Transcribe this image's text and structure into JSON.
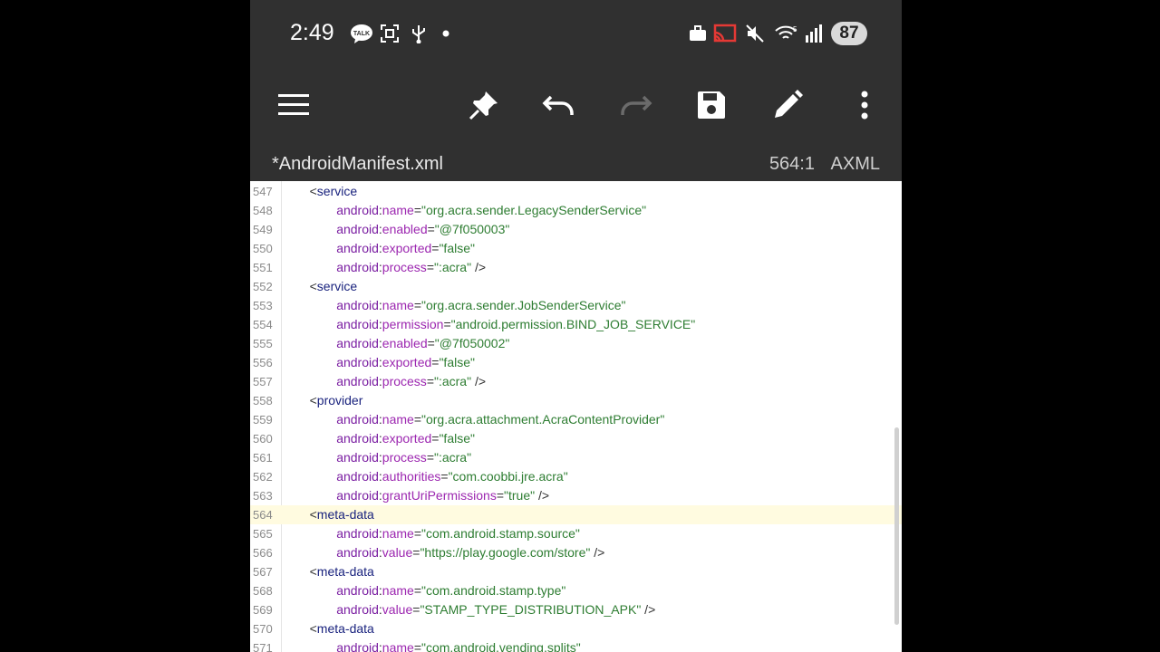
{
  "status_bar": {
    "time": "2:49",
    "icons_left": [
      "talk-icon",
      "screen-capture-icon",
      "usb-icon",
      "dot-icon"
    ],
    "icons_right": [
      "briefcase-icon",
      "cast-icon",
      "mute-icon",
      "wifi-icon",
      "signal-icon"
    ],
    "battery": "87"
  },
  "toolbar": {
    "buttons": [
      "menu-icon",
      "pin-icon",
      "undo-icon",
      "redo-icon",
      "save-icon",
      "edit-icon",
      "more-icon"
    ]
  },
  "file_info": {
    "filename": "*AndroidManifest.xml",
    "cursor_position": "564:1",
    "mode": "AXML"
  },
  "editor": {
    "current_line": "564",
    "lines": [
      {
        "n": "547",
        "indent": "    ",
        "parts": [
          [
            "punct",
            "<"
          ],
          [
            "tag",
            "service"
          ]
        ]
      },
      {
        "n": "548",
        "indent": "        ",
        "parts": [
          [
            "attrns",
            "android"
          ],
          [
            "punct",
            ":"
          ],
          [
            "attr",
            "name"
          ],
          [
            "punct",
            "="
          ],
          [
            "val",
            "\"org.acra.sender.LegacySenderService\""
          ]
        ]
      },
      {
        "n": "549",
        "indent": "        ",
        "parts": [
          [
            "attrns",
            "android"
          ],
          [
            "punct",
            ":"
          ],
          [
            "attr",
            "enabled"
          ],
          [
            "punct",
            "="
          ],
          [
            "val",
            "\"@7f050003\""
          ]
        ]
      },
      {
        "n": "550",
        "indent": "        ",
        "parts": [
          [
            "attrns",
            "android"
          ],
          [
            "punct",
            ":"
          ],
          [
            "attr",
            "exported"
          ],
          [
            "punct",
            "="
          ],
          [
            "val",
            "\"false\""
          ]
        ]
      },
      {
        "n": "551",
        "indent": "        ",
        "parts": [
          [
            "attrns",
            "android"
          ],
          [
            "punct",
            ":"
          ],
          [
            "attr",
            "process"
          ],
          [
            "punct",
            "="
          ],
          [
            "val",
            "\":acra\""
          ],
          [
            "punct",
            " />"
          ]
        ]
      },
      {
        "n": "552",
        "indent": "    ",
        "parts": [
          [
            "punct",
            "<"
          ],
          [
            "tag",
            "service"
          ]
        ]
      },
      {
        "n": "553",
        "indent": "        ",
        "parts": [
          [
            "attrns",
            "android"
          ],
          [
            "punct",
            ":"
          ],
          [
            "attr",
            "name"
          ],
          [
            "punct",
            "="
          ],
          [
            "val",
            "\"org.acra.sender.JobSenderService\""
          ]
        ]
      },
      {
        "n": "554",
        "indent": "        ",
        "parts": [
          [
            "attrns",
            "android"
          ],
          [
            "punct",
            ":"
          ],
          [
            "attr",
            "permission"
          ],
          [
            "punct",
            "="
          ],
          [
            "val",
            "\"android.permission.BIND_JOB_SERVICE\""
          ]
        ]
      },
      {
        "n": "555",
        "indent": "        ",
        "parts": [
          [
            "attrns",
            "android"
          ],
          [
            "punct",
            ":"
          ],
          [
            "attr",
            "enabled"
          ],
          [
            "punct",
            "="
          ],
          [
            "val",
            "\"@7f050002\""
          ]
        ]
      },
      {
        "n": "556",
        "indent": "        ",
        "parts": [
          [
            "attrns",
            "android"
          ],
          [
            "punct",
            ":"
          ],
          [
            "attr",
            "exported"
          ],
          [
            "punct",
            "="
          ],
          [
            "val",
            "\"false\""
          ]
        ]
      },
      {
        "n": "557",
        "indent": "        ",
        "parts": [
          [
            "attrns",
            "android"
          ],
          [
            "punct",
            ":"
          ],
          [
            "attr",
            "process"
          ],
          [
            "punct",
            "="
          ],
          [
            "val",
            "\":acra\""
          ],
          [
            "punct",
            " />"
          ]
        ]
      },
      {
        "n": "558",
        "indent": "    ",
        "parts": [
          [
            "punct",
            "<"
          ],
          [
            "tag",
            "provider"
          ]
        ]
      },
      {
        "n": "559",
        "indent": "        ",
        "parts": [
          [
            "attrns",
            "android"
          ],
          [
            "punct",
            ":"
          ],
          [
            "attr",
            "name"
          ],
          [
            "punct",
            "="
          ],
          [
            "val",
            "\"org.acra.attachment.AcraContentProvider\""
          ]
        ]
      },
      {
        "n": "560",
        "indent": "        ",
        "parts": [
          [
            "attrns",
            "android"
          ],
          [
            "punct",
            ":"
          ],
          [
            "attr",
            "exported"
          ],
          [
            "punct",
            "="
          ],
          [
            "val",
            "\"false\""
          ]
        ]
      },
      {
        "n": "561",
        "indent": "        ",
        "parts": [
          [
            "attrns",
            "android"
          ],
          [
            "punct",
            ":"
          ],
          [
            "attr",
            "process"
          ],
          [
            "punct",
            "="
          ],
          [
            "val",
            "\":acra\""
          ]
        ]
      },
      {
        "n": "562",
        "indent": "        ",
        "parts": [
          [
            "attrns",
            "android"
          ],
          [
            "punct",
            ":"
          ],
          [
            "attr",
            "authorities"
          ],
          [
            "punct",
            "="
          ],
          [
            "val",
            "\"com.coobbi.jre.acra\""
          ]
        ]
      },
      {
        "n": "563",
        "indent": "        ",
        "parts": [
          [
            "attrns",
            "android"
          ],
          [
            "punct",
            ":"
          ],
          [
            "attr",
            "grantUriPermissions"
          ],
          [
            "punct",
            "="
          ],
          [
            "val",
            "\"true\""
          ],
          [
            "punct",
            " />"
          ]
        ]
      },
      {
        "n": "564",
        "indent": "    ",
        "parts": [
          [
            "punct",
            "<"
          ],
          [
            "tag",
            "meta-data"
          ]
        ]
      },
      {
        "n": "565",
        "indent": "        ",
        "parts": [
          [
            "attrns",
            "android"
          ],
          [
            "punct",
            ":"
          ],
          [
            "attr",
            "name"
          ],
          [
            "punct",
            "="
          ],
          [
            "val",
            "\"com.android.stamp.source\""
          ]
        ]
      },
      {
        "n": "566",
        "indent": "        ",
        "parts": [
          [
            "attrns",
            "android"
          ],
          [
            "punct",
            ":"
          ],
          [
            "attr",
            "value"
          ],
          [
            "punct",
            "="
          ],
          [
            "val",
            "\"https://play.google.com/store\""
          ],
          [
            "punct",
            " />"
          ]
        ]
      },
      {
        "n": "567",
        "indent": "    ",
        "parts": [
          [
            "punct",
            "<"
          ],
          [
            "tag",
            "meta-data"
          ]
        ]
      },
      {
        "n": "568",
        "indent": "        ",
        "parts": [
          [
            "attrns",
            "android"
          ],
          [
            "punct",
            ":"
          ],
          [
            "attr",
            "name"
          ],
          [
            "punct",
            "="
          ],
          [
            "val",
            "\"com.android.stamp.type\""
          ]
        ]
      },
      {
        "n": "569",
        "indent": "        ",
        "parts": [
          [
            "attrns",
            "android"
          ],
          [
            "punct",
            ":"
          ],
          [
            "attr",
            "value"
          ],
          [
            "punct",
            "="
          ],
          [
            "val",
            "\"STAMP_TYPE_DISTRIBUTION_APK\""
          ],
          [
            "punct",
            " />"
          ]
        ]
      },
      {
        "n": "570",
        "indent": "    ",
        "parts": [
          [
            "punct",
            "<"
          ],
          [
            "tag",
            "meta-data"
          ]
        ]
      },
      {
        "n": "571",
        "indent": "        ",
        "parts": [
          [
            "attrns",
            "android"
          ],
          [
            "punct",
            ":"
          ],
          [
            "attr",
            "name"
          ],
          [
            "punct",
            "="
          ],
          [
            "val",
            "\"com.android.vending.splits\""
          ]
        ]
      }
    ]
  }
}
